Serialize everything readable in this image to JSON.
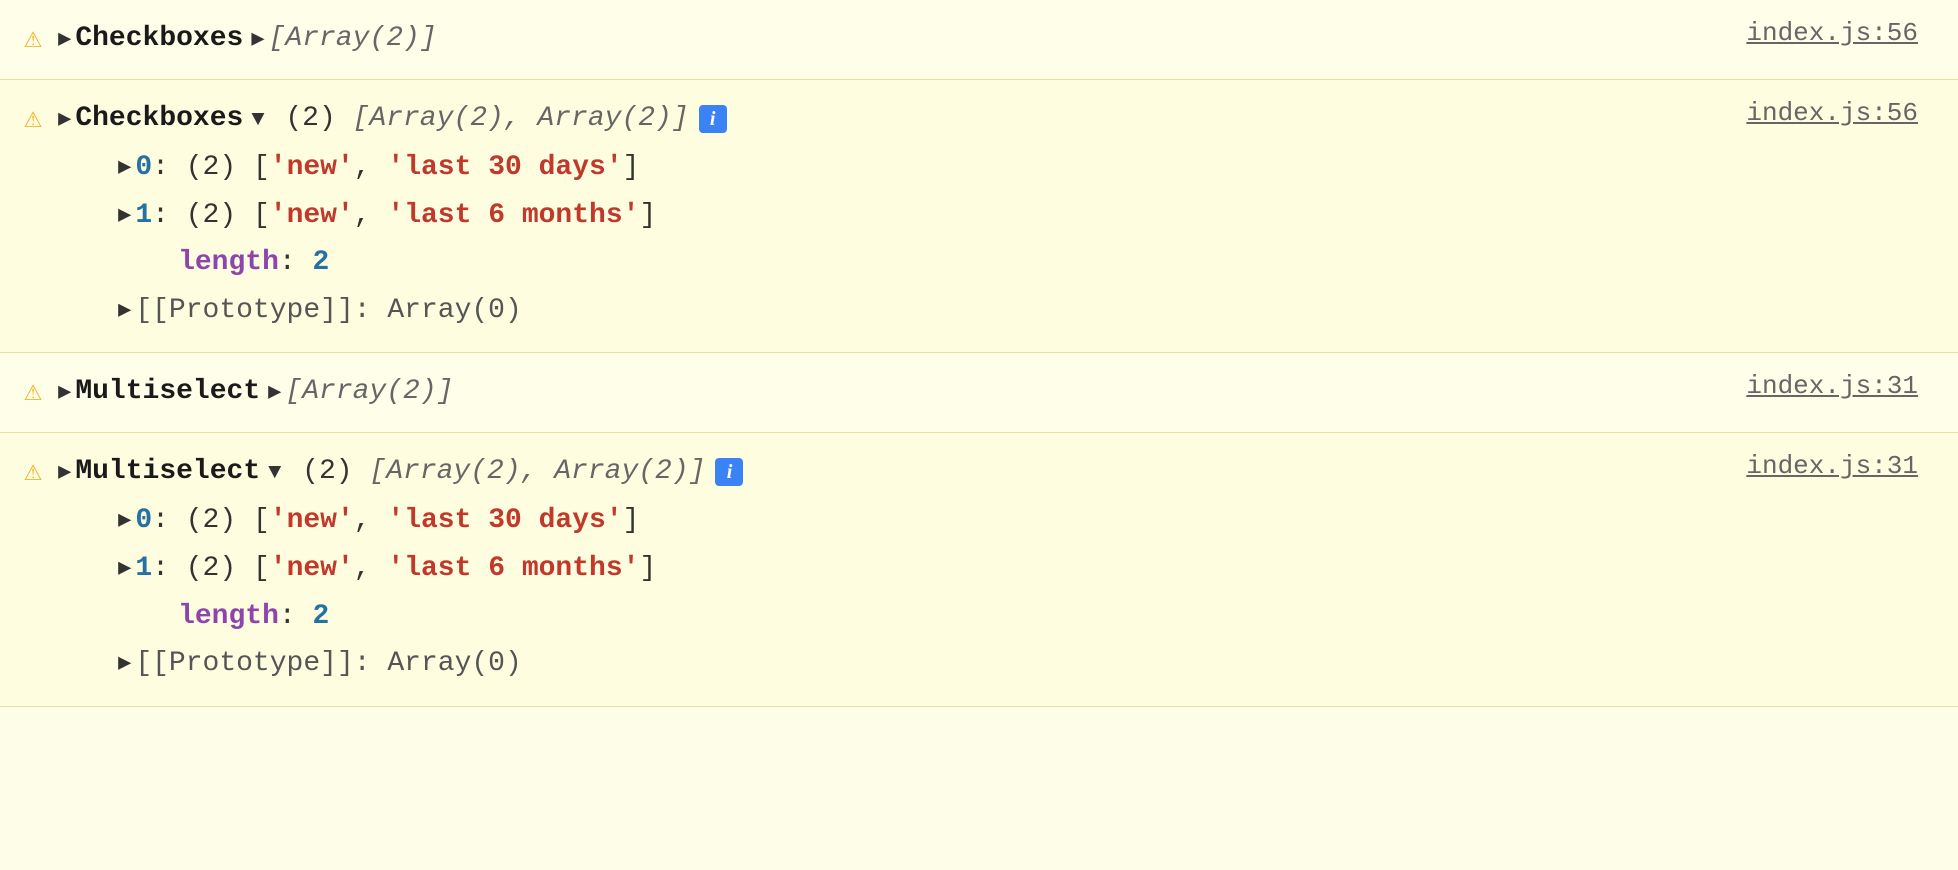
{
  "console": {
    "rows": [
      {
        "id": "row1",
        "icon": "⚠",
        "expanded": false,
        "component": "Checkboxes",
        "arrow_direction": "right",
        "summary": "[Array(2)]",
        "file_link": "index.js:56"
      },
      {
        "id": "row2",
        "icon": "⚠",
        "expanded": true,
        "component": "Checkboxes",
        "arrow_direction": "down",
        "count": "(2)",
        "summary": "[Array(2), Array(2)]",
        "has_info": true,
        "items": [
          {
            "index": "0",
            "count": "(2)",
            "values": [
              "'new'",
              "'last 30 days'"
            ]
          },
          {
            "index": "1",
            "count": "(2)",
            "values": [
              "'new'",
              "'last 6 months'"
            ]
          }
        ],
        "length_key": "length",
        "length_val": "2",
        "prototype_text": "[[Prototype]]: Array(0)",
        "file_link": "index.js:56"
      },
      {
        "id": "row3",
        "icon": "⚠",
        "expanded": false,
        "component": "Multiselect",
        "arrow_direction": "right",
        "summary": "[Array(2)]",
        "file_link": "index.js:31"
      },
      {
        "id": "row4",
        "icon": "⚠",
        "expanded": true,
        "component": "Multiselect",
        "arrow_direction": "down",
        "count": "(2)",
        "summary": "[Array(2), Array(2)]",
        "has_info": true,
        "items": [
          {
            "index": "0",
            "count": "(2)",
            "values": [
              "'new'",
              "'last 30 days'"
            ]
          },
          {
            "index": "1",
            "count": "(2)",
            "values": [
              "'new'",
              "'last 6 months'"
            ]
          }
        ],
        "length_key": "length",
        "length_val": "2",
        "prototype_text": "[[Prototype]]: Array(0)",
        "file_link": "index.js:31"
      }
    ]
  }
}
